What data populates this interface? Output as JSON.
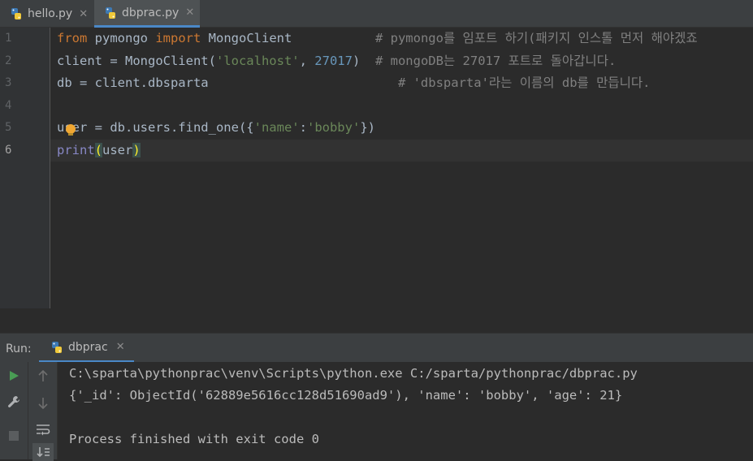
{
  "tabs": [
    {
      "label": "hello.py",
      "close": "✕"
    },
    {
      "label": "dbprac.py",
      "close": "✕"
    }
  ],
  "editor": {
    "line_numbers": [
      "1",
      "2",
      "3",
      "4",
      "5",
      "6"
    ],
    "current_line": "6",
    "lines": [
      {
        "t1": "from",
        "t2": " pymongo ",
        "t3": "import",
        "t4": " MongoClient           ",
        "c": "# pymongo를 임포트 하기(패키지 인스톨 먼저 해야겠죠"
      },
      {
        "t1": "client = MongoClient(",
        "s1": "'localhost'",
        "t2": ", ",
        "n1": "27017",
        "t3": ")  ",
        "c": "# mongoDB는 27017 포트로 돌아갑니다."
      },
      {
        "t1": "db = client.dbsparta                         ",
        "c": "# 'dbsparta'라는 이름의 db를 만듭니다."
      },
      {
        "t1": ""
      },
      {
        "t1": "user = db.users.find_one({",
        "s1": "'name'",
        "t2": ":",
        "s2": "'bobby'",
        "t3": "})"
      },
      {
        "f1": "print",
        "p1": "(",
        "t1": "user",
        "p2": ")"
      }
    ]
  },
  "run_panel": {
    "label": "Run:",
    "tab_label": "dbprac",
    "tab_close": "✕",
    "output": [
      "C:\\sparta\\pythonprac\\venv\\Scripts\\python.exe C:/sparta/pythonprac/dbprac.py",
      "{'_id': ObjectId('62889e5616cc128d51690ad9'), 'name': 'bobby', 'age': 21}",
      "",
      "Process finished with exit code 0"
    ]
  },
  "colors": {
    "keyword": "#cc7832",
    "string": "#6a8759",
    "number": "#6897bb",
    "comment": "#808080",
    "builtin": "#8888c6",
    "accent": "#4a88c7"
  }
}
